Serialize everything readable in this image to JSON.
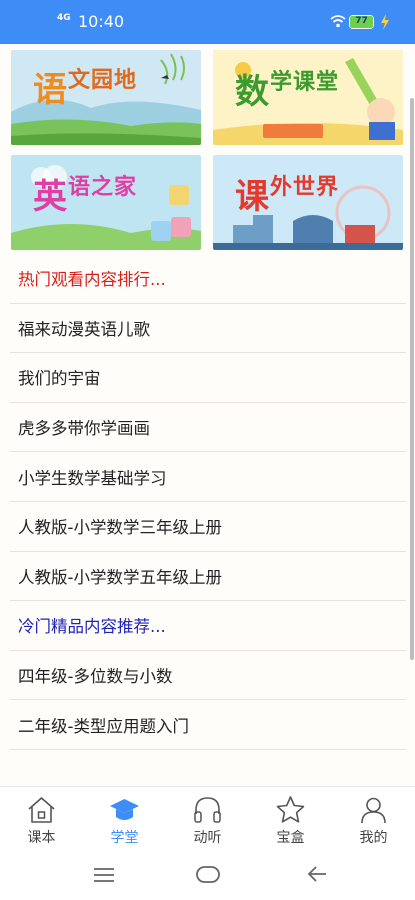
{
  "status_bar": {
    "network": "4G",
    "time": "10:40",
    "battery": "77"
  },
  "tiles": [
    {
      "first": "语",
      "rest": "文园地",
      "color": "#e0691c"
    },
    {
      "first": "数",
      "rest": "学课堂",
      "color": "#3d9a2c"
    },
    {
      "first": "英",
      "rest": "语之家",
      "color": "#e03ea3"
    },
    {
      "first": "课",
      "rest": "外世界",
      "color": "#e33a2d"
    }
  ],
  "hot": {
    "header": "热门观看内容排行...",
    "items": [
      "福来动漫英语儿歌",
      "我们的宇宙",
      "虎多多带你学画画",
      "小学生数学基础学习",
      "人教版-小学数学三年级上册",
      "人教版-小学数学五年级上册"
    ]
  },
  "cold": {
    "header": "冷门精品内容推荐...",
    "items": [
      "四年级-多位数与小数",
      "二年级-类型应用题入门"
    ]
  },
  "tabbar": {
    "active": "学堂",
    "tabs": [
      {
        "label": "课本",
        "icon": "house-icon"
      },
      {
        "label": "学堂",
        "icon": "graduation-cap-icon"
      },
      {
        "label": "动听",
        "icon": "headphones-icon"
      },
      {
        "label": "宝盒",
        "icon": "star-icon"
      },
      {
        "label": "我的",
        "icon": "person-icon"
      }
    ]
  },
  "colors": {
    "accent": "#3e8cf5",
    "hot": "#d6201c",
    "cold": "#1e24b8"
  }
}
